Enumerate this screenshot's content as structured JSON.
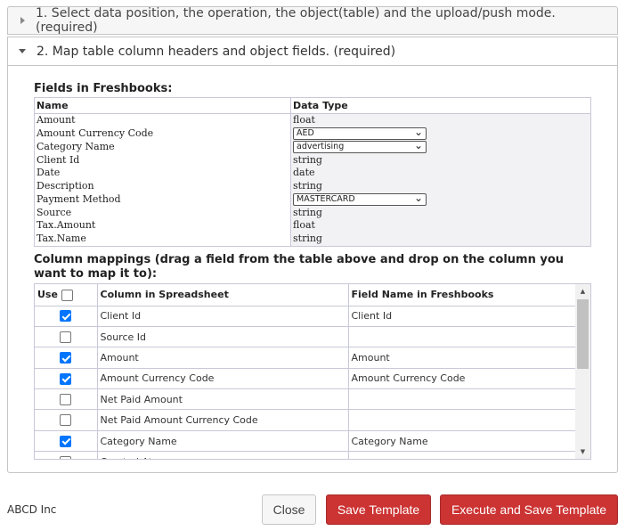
{
  "step1": {
    "label": "1. Select data position, the operation, the object(table) and the upload/push mode. (required)"
  },
  "step2": {
    "label": "2. Map table column headers and object fields. (required)"
  },
  "fields": {
    "title": "Fields in Freshbooks:",
    "headers": {
      "name": "Name",
      "type": "Data Type"
    },
    "rows": [
      {
        "name": "Amount",
        "type": "float",
        "select": null
      },
      {
        "name": "Amount Currency Code",
        "type": "",
        "select": "AED"
      },
      {
        "name": "Category Name",
        "type": "",
        "select": "advertising"
      },
      {
        "name": "Client Id",
        "type": "string",
        "select": null
      },
      {
        "name": "Date",
        "type": "date",
        "select": null
      },
      {
        "name": "Description",
        "type": "string",
        "select": null
      },
      {
        "name": "Payment Method",
        "type": "",
        "select": "MASTERCARD"
      },
      {
        "name": "Source",
        "type": "string",
        "select": null
      },
      {
        "name": "Tax.Amount",
        "type": "float",
        "select": null
      },
      {
        "name": "Tax.Name",
        "type": "string",
        "select": null
      }
    ]
  },
  "mappings": {
    "title": "Column mappings (drag a field from the table above and drop on the column you want to map it to):",
    "headers": {
      "use": "Use",
      "column": "Column in Spreadsheet",
      "field": "Field Name in Freshbooks"
    },
    "rows": [
      {
        "checked": true,
        "column": "Client Id",
        "field": "Client Id"
      },
      {
        "checked": false,
        "column": "Source Id",
        "field": ""
      },
      {
        "checked": true,
        "column": "Amount",
        "field": "Amount"
      },
      {
        "checked": true,
        "column": "Amount Currency Code",
        "field": "Amount Currency Code"
      },
      {
        "checked": false,
        "column": "Net Paid Amount",
        "field": ""
      },
      {
        "checked": false,
        "column": "Net Paid Amount Currency Code",
        "field": ""
      },
      {
        "checked": true,
        "column": "Category Name",
        "field": "Category Name"
      },
      {
        "checked": false,
        "column": "Created At",
        "field": ""
      }
    ]
  },
  "footer": {
    "company": "ABCD Inc",
    "close_label": "Close",
    "save_label": "Save Template",
    "execute_label": "Execute and Save Template"
  },
  "colors": {
    "accent_red": "#cc3333",
    "checkbox_blue": "#0075ff"
  }
}
